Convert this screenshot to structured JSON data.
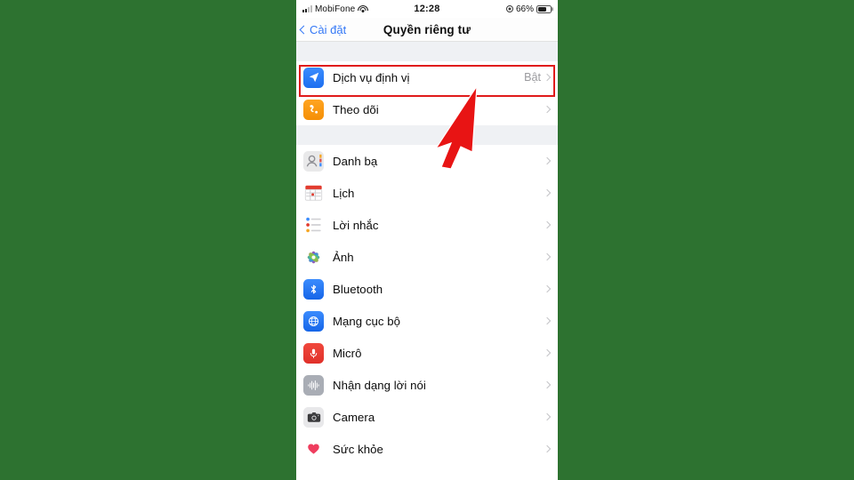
{
  "background_color": "#2d7230",
  "accent_color": "#3478f6",
  "highlight_color": "#e01b1b",
  "status_bar": {
    "carrier": "MobiFone",
    "signal_icon": "signal-bars-icon",
    "wifi_icon": "wifi-icon",
    "time": "12:28",
    "location_icon": "location-services-icon",
    "battery_percent": "66%",
    "battery_icon": "battery-icon",
    "battery_level": 66
  },
  "nav": {
    "back_label": "Cài đặt",
    "back_icon": "chevron-left-icon",
    "title": "Quyền riêng tư"
  },
  "groups": [
    {
      "rows": [
        {
          "icon": "location-arrow-icon",
          "label": "Dịch vụ định vị",
          "value": "Bật",
          "highlighted": true
        },
        {
          "icon": "tracking-icon",
          "label": "Theo dõi",
          "value": ""
        }
      ]
    },
    {
      "rows": [
        {
          "icon": "contacts-icon",
          "label": "Danh bạ",
          "value": ""
        },
        {
          "icon": "calendar-icon",
          "label": "Lịch",
          "value": ""
        },
        {
          "icon": "reminders-icon",
          "label": "Lời nhắc",
          "value": ""
        },
        {
          "icon": "photos-icon",
          "label": "Ảnh",
          "value": ""
        },
        {
          "icon": "bluetooth-icon",
          "label": "Bluetooth",
          "value": ""
        },
        {
          "icon": "local-network-icon",
          "label": "Mạng cục bộ",
          "value": ""
        },
        {
          "icon": "microphone-icon",
          "label": "Micrô",
          "value": ""
        },
        {
          "icon": "speech-recognition-icon",
          "label": "Nhận dạng lời nói",
          "value": ""
        },
        {
          "icon": "camera-icon",
          "label": "Camera",
          "value": ""
        },
        {
          "icon": "health-icon",
          "label": "Sức khỏe",
          "value": ""
        }
      ]
    }
  ],
  "annotation": {
    "arrow_icon": "red-arrow-cursor-icon",
    "arrow_color": "#e81414"
  }
}
